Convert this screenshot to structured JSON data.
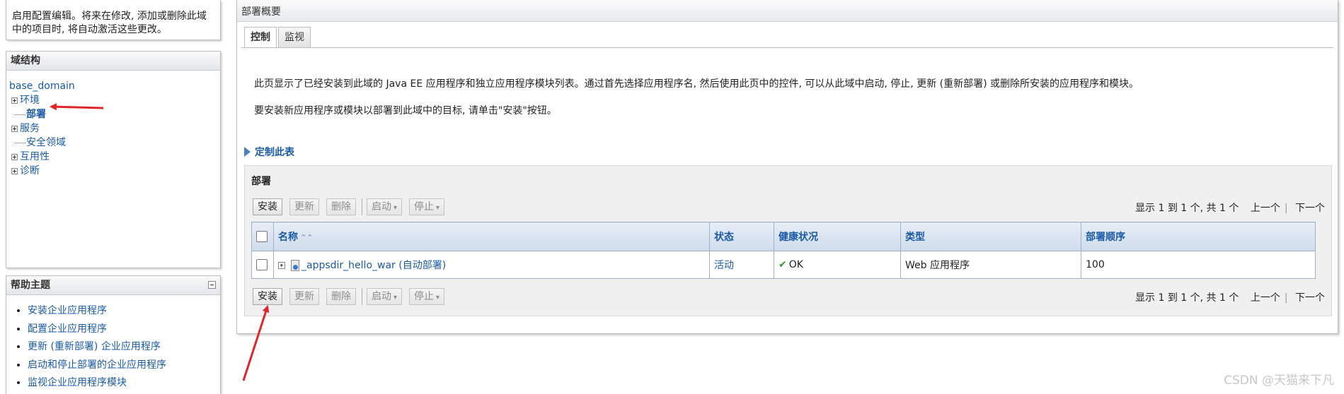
{
  "change_center": {
    "message": "启用配置编辑。将来在修改, 添加或删除此域中的项目时, 将自动激活这些更改。"
  },
  "domain_structure": {
    "title": "域结构",
    "root": "base_domain",
    "items": [
      {
        "label": "环境",
        "expandable": true
      },
      {
        "label": "部署",
        "expandable": false,
        "selected": true
      },
      {
        "label": "服务",
        "expandable": true
      },
      {
        "label": "安全领域",
        "expandable": false
      },
      {
        "label": "互用性",
        "expandable": true
      },
      {
        "label": "诊断",
        "expandable": true
      }
    ]
  },
  "help": {
    "title": "帮助主题",
    "items": [
      "安装企业应用程序",
      "配置企业应用程序",
      "更新 (重新部署) 企业应用程序",
      "启动和停止部署的企业应用程序",
      "监视企业应用程序模块"
    ]
  },
  "main": {
    "header": "部署概要",
    "tabs": [
      "控制",
      "监视"
    ],
    "description": "此页显示了已经安装到此域的 Java EE 应用程序和独立应用程序模块列表。通过首先选择应用程序名, 然后使用此页中的控件, 可以从此域中启动, 停止, 更新 (重新部署) 或删除所安装的应用程序和模块。",
    "install_hint": "要安装新应用程序或模块以部署到此域中的目标, 请单击\"安装\"按钮。",
    "customize": "定制此表",
    "section_title": "部署",
    "toolbar": {
      "install": "安装",
      "update": "更新",
      "delete": "删除",
      "start": "启动",
      "stop": "停止"
    },
    "pager": {
      "range": "显示 1 到 1 个, 共 1 个",
      "prev": "上一个",
      "next": "下一个"
    },
    "table": {
      "columns": [
        "名称",
        "状态",
        "健康状况",
        "类型",
        "部署顺序"
      ],
      "rows": [
        {
          "name": "_appsdir_hello_war (自动部署)",
          "state": "活动",
          "health": "OK",
          "type": "Web 应用程序",
          "order": "100"
        }
      ]
    }
  },
  "watermark": "CSDN @天猫来下凡",
  "colors": {
    "link": "#1a5aa6",
    "annotation_arrow": "#e0262b",
    "health_ok": "#2e9a2e"
  }
}
